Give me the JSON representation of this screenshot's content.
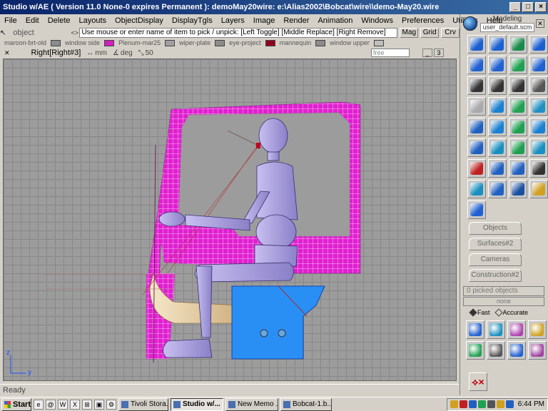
{
  "window": {
    "title": "Studio w/AE ( Version 11.0 None-0 expires Permanent ): demoMay20wire: e:\\Alias2002\\Bobcat\\wire\\\\demo-May20.wire",
    "buttons": {
      "minimize": "_",
      "maximize": "□",
      "close": "×"
    }
  },
  "menu": [
    "File",
    "Edit",
    "Delete",
    "Layouts",
    "ObjectDisplay",
    "DisplayTgls",
    "Layers",
    "Image",
    "Render",
    "Animation",
    "Windows",
    "Preferences",
    "Utilities",
    "Help"
  ],
  "command": {
    "pick_label": "object",
    "arrows": "<>",
    "prompt": "Use mouse or enter name of item to pick / unpick: [Left Toggle] [Middle Replace] [Right Remove]",
    "buttons": [
      "Mag",
      "Grid",
      "Crv"
    ]
  },
  "layers": [
    {
      "name": "maroon-brt-old",
      "color": "#8c8c8c"
    },
    {
      "name": "window side",
      "color": "#d020c0"
    },
    {
      "name": "Plenum-mar25",
      "color": "#a0a0a0"
    },
    {
      "name": "wiper-plate",
      "color": "#8c8c8c"
    },
    {
      "name": "eye-project",
      "color": "#900020"
    },
    {
      "name": "mannequin",
      "color": "#8c8c8c"
    },
    {
      "name": "window upper",
      "color": "#c0c0c0"
    }
  ],
  "viewport": {
    "name": "Right[Right#3]",
    "unit_mm": "mm",
    "unit_deg": "deg",
    "unit_val": "50",
    "mode_field": "free",
    "field_num": "3",
    "axis_x": "y",
    "axis_y": "z"
  },
  "status": "Ready",
  "palette": {
    "mode": "Modeling",
    "file": "user_default.scm",
    "shelves": [
      "Objects",
      "Surfaces#2",
      "Cameras",
      "Construction#2"
    ],
    "picked": "0 picked objects",
    "picked_value": "none",
    "quality": {
      "fast": "Fast",
      "accurate": "Accurate"
    },
    "tool_icons": [
      "curve-cv-icon",
      "curve-ep-icon",
      "curve-blend-icon",
      "curve-edit-icon",
      "line-icon",
      "arc-icon",
      "spline-icon",
      "rebuild-icon",
      "pick-icon",
      "camera-icon",
      "lamp-icon",
      "render-icon",
      "plane-icon",
      "surface-icon",
      "surface-trim-icon",
      "skin-icon",
      "revolve-icon",
      "extrude-icon",
      "rail-icon",
      "fillet-icon",
      "boundary-icon",
      "square-icon",
      "blend-icon",
      "offset-icon",
      "delete-icon",
      "cluster-icon",
      "group-icon",
      "person-icon",
      "mesh-icon",
      "mesh2-icon",
      "sphere-icon",
      "light-icon",
      "align-icon"
    ],
    "tool_colors": [
      "#1a5fd0",
      "#1a5fd0",
      "#1a8a4a",
      "#1a5fd0",
      "#2060d0",
      "#2060d0",
      "#20a050",
      "#2060d0",
      "#333333",
      "#333333",
      "#333333",
      "#555555",
      "#aaaaaa",
      "#1a80d0",
      "#20a050",
      "#2090c0",
      "#2060c0",
      "#1a80d0",
      "#20a050",
      "#1a80d0",
      "#2060c0",
      "#1a90c0",
      "#20a050",
      "#1a90c0",
      "#c02020",
      "#2060c0",
      "#2060c0",
      "#333333",
      "#1a90c0",
      "#2060c0",
      "#1a50a0",
      "#d0a020",
      "#2060d0"
    ],
    "bottom_icons": [
      "box-icon",
      "sphere-icon",
      "cone-icon",
      "torus-icon",
      "cylinder-icon",
      "striped-icon",
      "capsule-icon",
      "round-icon"
    ],
    "bottom_colors": [
      "#2060d0",
      "#1a90c0",
      "#b040b0",
      "#d0a020",
      "#20a050",
      "#555555",
      "#2060d0",
      "#a040a0"
    ],
    "bottom_tool": "⟡×"
  },
  "taskbar": {
    "start": "Start",
    "quicklaunch": [
      "e",
      "@",
      "W",
      "X",
      "⊞",
      "▣",
      "⚙"
    ],
    "tasks": [
      {
        "label": "Tivoli Stora...",
        "active": false
      },
      {
        "label": "Studio w/...",
        "active": true
      },
      {
        "label": "New Memo ...",
        "active": false
      },
      {
        "label": "Bobcat-1.b...",
        "active": false
      }
    ],
    "time": "6:44 PM",
    "tray_colors": [
      "#d0a020",
      "#c02020",
      "#2060c0",
      "#20a050",
      "#555555",
      "#d0a020",
      "#2060c0"
    ]
  }
}
